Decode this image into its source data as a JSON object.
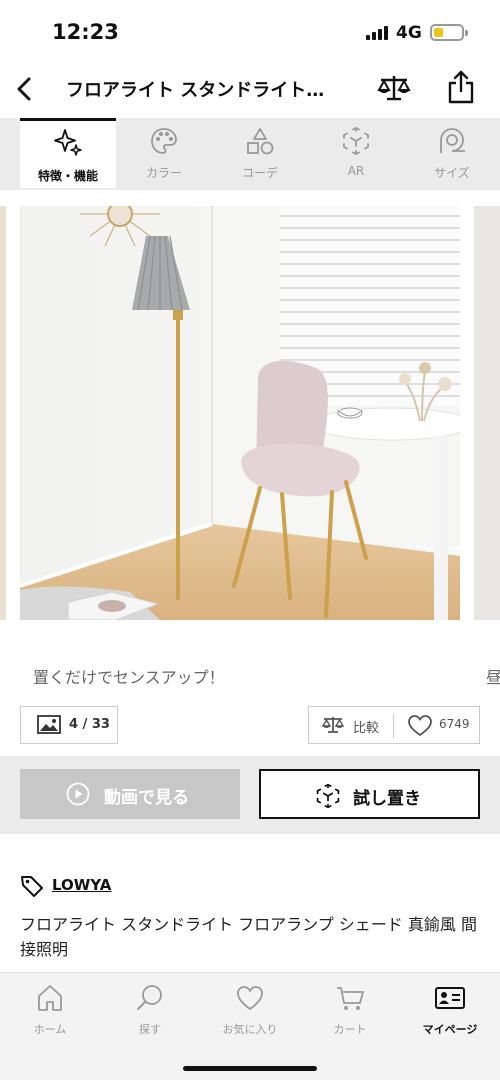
{
  "status_bar": {
    "time": "12:23",
    "network": "4G"
  },
  "header": {
    "title": "フロアライト スタンドライト…"
  },
  "tabs": [
    {
      "label": "特徴・機能",
      "icon": "sparkle-icon",
      "active": true
    },
    {
      "label": "カラー",
      "icon": "palette-icon",
      "active": false
    },
    {
      "label": "コーデ",
      "icon": "shapes-icon",
      "active": false
    },
    {
      "label": "AR",
      "icon": "ar-cube-icon",
      "active": false
    },
    {
      "label": "サイズ",
      "icon": "tape-measure-icon",
      "active": false
    }
  ],
  "gallery": {
    "caption": "置くだけでセンスアップ！",
    "next_caption": "昼",
    "counter": "4 / 33"
  },
  "actions": {
    "compare_label": "比較",
    "like_count": "6749"
  },
  "buttons": {
    "video_label": "動画で見る",
    "try_label": "試し置き"
  },
  "product": {
    "brand": "LOWYA",
    "title": "フロアライト スタンドライト フロアランプ シェード 真鍮風 間接照明"
  },
  "bottom_nav": [
    {
      "label": "ホーム",
      "icon": "home-icon",
      "active": false
    },
    {
      "label": "探す",
      "icon": "search-icon",
      "active": false
    },
    {
      "label": "お気に入り",
      "icon": "heart-icon",
      "active": false
    },
    {
      "label": "カート",
      "icon": "cart-icon",
      "active": false
    },
    {
      "label": "マイページ",
      "icon": "id-card-icon",
      "active": true
    }
  ],
  "colors": {
    "accent": "#111111",
    "disabled_button": "#c7c7c7",
    "band_bg": "#ebebeb",
    "star": "#f3b728"
  }
}
